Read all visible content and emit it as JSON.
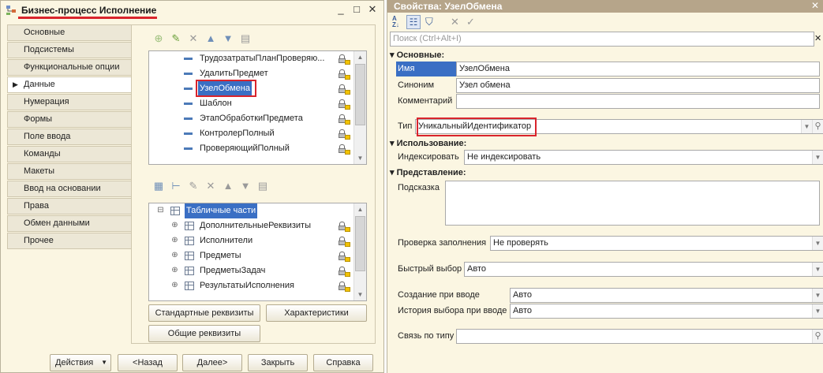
{
  "left_window": {
    "title": "Бизнес-процесс Исполнение",
    "window_controls": {
      "minimize": "_",
      "maximize": "□",
      "close": "✕"
    },
    "nav_items": [
      {
        "label": "Основные"
      },
      {
        "label": "Подсистемы"
      },
      {
        "label": "Функциональные опции"
      },
      {
        "label": "Данные"
      },
      {
        "label": "Нумерация"
      },
      {
        "label": "Формы"
      },
      {
        "label": "Поле ввода"
      },
      {
        "label": "Команды"
      },
      {
        "label": "Макеты"
      },
      {
        "label": "Ввод на основании"
      },
      {
        "label": "Права"
      },
      {
        "label": "Обмен данными"
      },
      {
        "label": "Прочее"
      }
    ],
    "selected_nav": "Данные",
    "attributes": [
      {
        "label": "ТрудозатратыПланПроверяю..."
      },
      {
        "label": "УдалитьПредмет"
      },
      {
        "label": "УзелОбмена"
      },
      {
        "label": "Шаблон"
      },
      {
        "label": "ЭтапОбработкиПредмета"
      },
      {
        "label": "КонтролерПолный"
      },
      {
        "label": "ПроверяющийПолный"
      }
    ],
    "tabular_root": "Табличные части",
    "tabular_parts": [
      {
        "label": "ДополнительныеРеквизиты"
      },
      {
        "label": "Исполнители"
      },
      {
        "label": "Предметы"
      },
      {
        "label": "ПредметыЗадач"
      },
      {
        "label": "РезультатыИсполнения"
      }
    ],
    "buttons": {
      "standard_attrs": "Стандартные реквизиты",
      "characteristics": "Характеристики",
      "common_attrs": "Общие реквизиты",
      "actions": "Действия",
      "back": "<Назад",
      "next": "Далее>",
      "close": "Закрыть",
      "help": "Справка"
    }
  },
  "right_window": {
    "title": "Свойства: УзелОбмена",
    "search_placeholder": "Поиск (Ctrl+Alt+I)",
    "sections": {
      "main": "Основные:",
      "usage": "Использование:",
      "presentation": "Представление:"
    },
    "labels": {
      "name": "Имя",
      "synonym": "Синоним",
      "comment": "Комментарий",
      "type": "Тип",
      "indexing": "Индексировать",
      "tooltip": "Подсказка",
      "fill_check": "Проверка заполнения",
      "quick_choice": "Быстрый выбор",
      "create_on_input": "Создание при вводе",
      "choice_history": "История выбора при вводе",
      "link_by_type": "Связь по типу"
    },
    "values": {
      "name": "УзелОбмена",
      "synonym": "Узел обмена",
      "comment": "",
      "type": "УникальныйИдентификатор",
      "indexing": "Не индексировать",
      "tooltip": "",
      "fill_check": "Не проверять",
      "quick_choice": "Авто",
      "create_on_input": "Авто",
      "choice_history": "Авто",
      "link_by_type": ""
    }
  },
  "colors": {
    "panel_bg": "#fbf6e2",
    "title_bar_right": "#b6a58a",
    "highlight_red": "#d9242c",
    "selection_blue": "#3a6fc4"
  }
}
